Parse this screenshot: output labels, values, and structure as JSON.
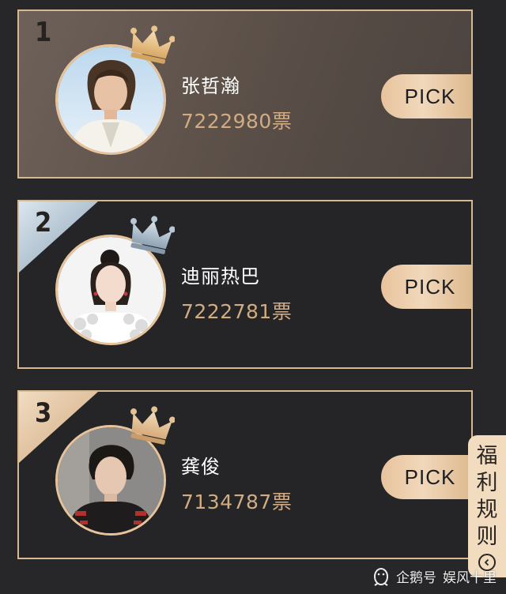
{
  "ranking": [
    {
      "rank": "1",
      "name": "张哲瀚",
      "votes": "7222980票",
      "button": "PICK"
    },
    {
      "rank": "2",
      "name": "迪丽热巴",
      "votes": "7222781票",
      "button": "PICK"
    },
    {
      "rank": "3",
      "name": "龚俊",
      "votes": "7134787票",
      "button": "PICK"
    }
  ],
  "rules_tab": {
    "chars": [
      "福",
      "利",
      "规",
      "则"
    ]
  },
  "watermark": {
    "source": "企鹅号",
    "author": "娱风十里"
  },
  "colors": {
    "background": "#272729",
    "border": "#d8b88e",
    "gold": "#e6c39a",
    "votes": "#d1ab82",
    "silver": "#9fb2c2",
    "bronze": "#e5c6a0"
  }
}
